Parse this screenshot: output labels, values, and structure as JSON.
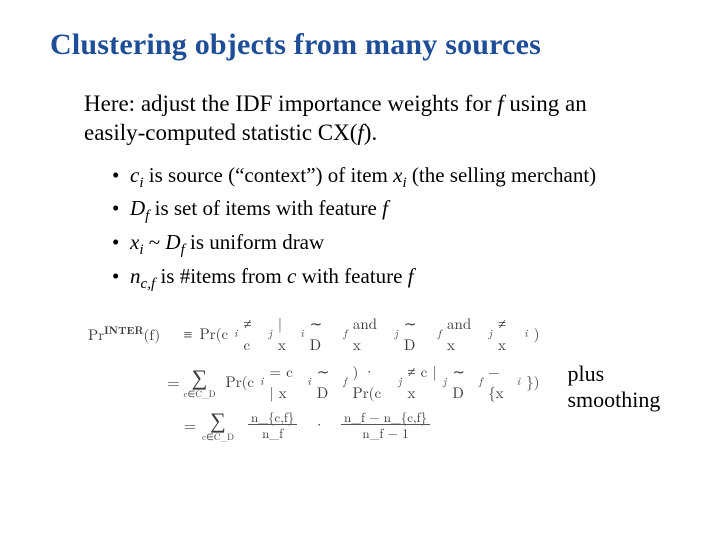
{
  "title": "Clustering objects from many sources",
  "intro": {
    "pre": "Here: adjust the IDF importance weights for ",
    "f": "f",
    "post": " using an easily-computed statistic CX(",
    "f2": "f",
    "tail": ")."
  },
  "bullets": [
    {
      "c": "c",
      "ci": "i",
      "mid1": " is source (“context”) of item ",
      "x": "x",
      "xi": "i",
      "tail": " (the selling merchant)"
    },
    {
      "D": "D",
      "Df": "f",
      "mid1": " is set of items with feature ",
      "f": "f"
    },
    {
      "x": "x",
      "xi": "i",
      "mid1": " ~ ",
      "D": "D",
      "Df": "f",
      "tail": " is uniform draw"
    },
    {
      "n": "n",
      "ncf": "c,f",
      "mid1": " is #items from ",
      "c": "c",
      "mid2": " with feature ",
      "f": "f"
    }
  ],
  "eq": {
    "label_pre": "Pr",
    "label_sup": "INTER",
    "label_arg": "(f)",
    "op1": "≡",
    "row1": {
      "pre": "Pr(c",
      "i": "i",
      "ne": " ≠ c",
      "j": "j",
      "mid": " | x",
      "xi": "i",
      "sim": " ∼ D",
      "df": "f",
      "and1": " and x",
      "xj": "j",
      "sim2": " ∼ D",
      "df2": "f",
      "and2": " and x",
      "xj2": "j",
      "ne2": " ≠ x",
      "xi2": "i",
      "close": ")"
    },
    "op2": "=",
    "row2": {
      "sum_under": "c∈C_D",
      "t1": "Pr(c",
      "i": "i",
      "eqc": " = c | x",
      "xi": "i",
      "sim": " ∼ D",
      "df": "f",
      "close1": ") · Pr(c",
      "j": "j",
      "nec": " ≠ c | x",
      "xj": "j",
      "sim2": " ∼ D",
      "df2": "f",
      "minus": " − {x",
      "xi2": "i",
      "close2": "})"
    },
    "op3": "=",
    "row3": {
      "sum_under": "c∈C_D",
      "f1_num": "n_{c,f}",
      "f1_den": "n_f",
      "dot": "·",
      "f2_num": "n_f − n_{c,f}",
      "f2_den": "n_f − 1"
    }
  },
  "note": "plus smoothing"
}
